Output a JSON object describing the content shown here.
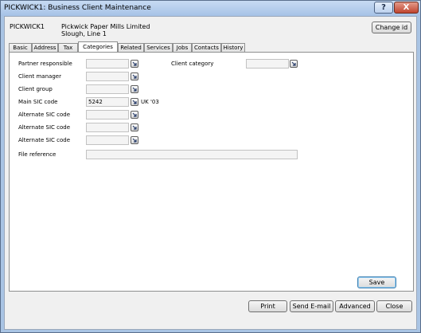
{
  "window": {
    "title": "PICKWICK1: Business Client Maintenance",
    "help_label": "?",
    "close_label": "X"
  },
  "header": {
    "client_code": "PICKWICK1",
    "client_name_line1": "Pickwick Paper Mills Limited",
    "client_name_line2": "Slough, Line 1",
    "change_id_label": "Change id"
  },
  "tabs": [
    {
      "label": "Basic"
    },
    {
      "label": "Address"
    },
    {
      "label": "Tax"
    },
    {
      "label": "Categories"
    },
    {
      "label": "Related"
    },
    {
      "label": "Services"
    },
    {
      "label": "Jobs"
    },
    {
      "label": "Contacts"
    },
    {
      "label": "History"
    }
  ],
  "active_tab": "Categories",
  "form": {
    "partner_responsible": {
      "label": "Partner responsible",
      "value": ""
    },
    "client_manager": {
      "label": "Client manager",
      "value": ""
    },
    "client_group": {
      "label": "Client group",
      "value": ""
    },
    "main_sic_code": {
      "label": "Main SIC code",
      "value": "5242",
      "suffix": "UK '03"
    },
    "alt_sic_1": {
      "label": "Alternate SIC code",
      "value": ""
    },
    "alt_sic_2": {
      "label": "Alternate SIC code",
      "value": ""
    },
    "alt_sic_3": {
      "label": "Alternate SIC code",
      "value": ""
    },
    "file_reference": {
      "label": "File reference",
      "value": ""
    },
    "client_category": {
      "label": "Client category",
      "value": ""
    }
  },
  "buttons": {
    "save": "Save",
    "print": "Print",
    "send_email": "Send E-mail",
    "advanced": "Advanced",
    "close": "Close"
  },
  "icons": {
    "lookup": "lookup-arrow-icon"
  }
}
